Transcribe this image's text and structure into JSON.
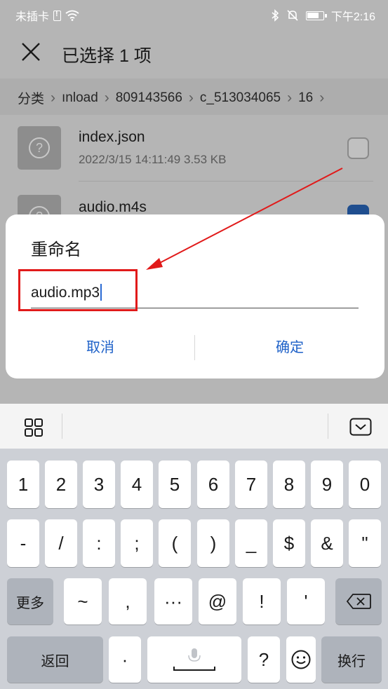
{
  "status_bar": {
    "carrier": "未插卡",
    "time": "下午2:16"
  },
  "title_bar": {
    "title": "已选择 1 项"
  },
  "breadcrumb": [
    "分类",
    "ınload",
    "809143566",
    "c_513034065",
    "16"
  ],
  "files": [
    {
      "name": "index.json",
      "meta": "2022/3/15 14:11:49 3.53 KB",
      "checked": false
    },
    {
      "name": "audio.m4s",
      "meta": "",
      "checked": true
    }
  ],
  "dialog": {
    "title": "重命名",
    "input_value": "audio.mp3",
    "cancel_label": "取消",
    "confirm_label": "确定"
  },
  "annotation": {
    "highlight_color": "#e11a1a"
  },
  "keyboard": {
    "row1": [
      "1",
      "2",
      "3",
      "4",
      "5",
      "6",
      "7",
      "8",
      "9",
      "0"
    ],
    "row2": [
      "-",
      "/",
      ":",
      ";",
      "(",
      ")",
      "_",
      "$",
      "&",
      "\""
    ],
    "row3": {
      "more_label": "更多",
      "keys": [
        "~",
        ",",
        "···",
        "@",
        "!",
        "'"
      ]
    },
    "row4": {
      "back_label": "返回",
      "dot": "·",
      "question": "?",
      "enter_label": "换行"
    }
  },
  "colors": {
    "accent": "#1e61c8",
    "checkbox_checked": "#1f4e8f",
    "annotation_red": "#e11a1a"
  }
}
